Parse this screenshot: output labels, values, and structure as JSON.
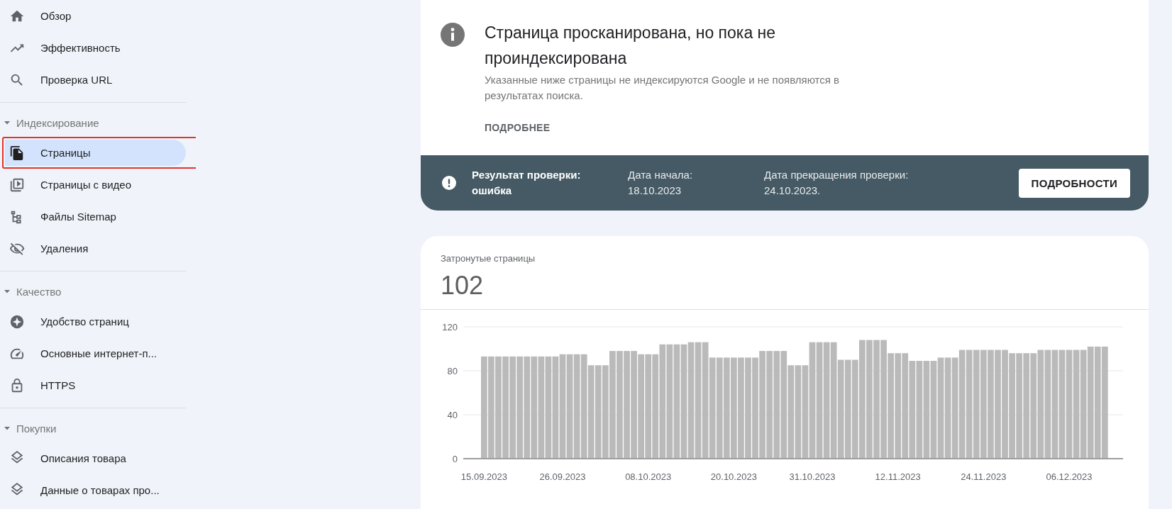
{
  "sidebar": {
    "sections": [
      {
        "items": [
          {
            "label": "Обзор",
            "selected": false,
            "outlined": false
          },
          {
            "label": "Эффективность",
            "selected": false,
            "outlined": false
          },
          {
            "label": "Проверка URL",
            "selected": false,
            "outlined": false
          }
        ]
      },
      {
        "header": "Индексирование",
        "expanded": true,
        "items": [
          {
            "label": "Страницы",
            "selected": true,
            "outlined": true
          },
          {
            "label": "Страницы с видео",
            "selected": false,
            "outlined": false
          },
          {
            "label": "Файлы Sitemap",
            "selected": false,
            "outlined": false
          },
          {
            "label": "Удаления",
            "selected": false,
            "outlined": false
          }
        ]
      },
      {
        "header": "Качество",
        "expanded": true,
        "items": [
          {
            "label": "Удобство страниц",
            "selected": false,
            "outlined": false
          },
          {
            "label": "Основные интернет-п...",
            "selected": false,
            "outlined": false
          },
          {
            "label": "HTTPS",
            "selected": false,
            "outlined": false
          }
        ]
      },
      {
        "header": "Покупки",
        "expanded": true,
        "items": [
          {
            "label": "Описания товара",
            "selected": false,
            "outlined": false
          },
          {
            "label": "Данные о товарах про...",
            "selected": false,
            "outlined": false
          }
        ]
      }
    ]
  },
  "issue": {
    "title": "Страница просканирована, но пока не проиндексирована",
    "description": "Указанные ниже страницы не индексируются Google и не появляются в результатах поиска.",
    "link": "ПОДРОБНЕЕ",
    "validation": {
      "result": "Результат проверки: ошибка",
      "start": "Дата начала: 18.10.2023",
      "end": "Дата прекращения проверки: 24.10.2023.",
      "button": "ПОДРОБНОСТИ"
    }
  },
  "affected": {
    "label": "Затронутые страницы",
    "count": "102",
    "chart_data": {
      "type": "bar",
      "yticks": [
        0,
        40,
        80,
        120
      ],
      "ylim": [
        0,
        120
      ],
      "categories": [
        "15.09.2023",
        null,
        null,
        null,
        null,
        null,
        null,
        null,
        null,
        null,
        null,
        "26.09.2023",
        null,
        null,
        null,
        null,
        null,
        null,
        null,
        null,
        null,
        null,
        null,
        "08.10.2023",
        null,
        null,
        null,
        null,
        null,
        null,
        null,
        null,
        null,
        null,
        null,
        "20.10.2023",
        null,
        null,
        null,
        null,
        null,
        null,
        null,
        null,
        null,
        null,
        "31.10.2023",
        null,
        null,
        null,
        null,
        null,
        null,
        null,
        null,
        null,
        null,
        null,
        "12.11.2023",
        null,
        null,
        null,
        null,
        null,
        null,
        null,
        null,
        null,
        null,
        null,
        "24.11.2023",
        null,
        null,
        null,
        null,
        null,
        null,
        null,
        null,
        null,
        null,
        null,
        "06.12.2023",
        null,
        null,
        null,
        null,
        null
      ],
      "values": [
        93,
        93,
        93,
        93,
        93,
        93,
        93,
        93,
        93,
        93,
        93,
        95,
        95,
        95,
        95,
        85,
        85,
        85,
        98,
        98,
        98,
        98,
        95,
        95,
        95,
        104,
        104,
        104,
        104,
        106,
        106,
        106,
        92,
        92,
        92,
        92,
        92,
        92,
        92,
        98,
        98,
        98,
        98,
        85,
        85,
        85,
        106,
        106,
        106,
        106,
        90,
        90,
        90,
        108,
        108,
        108,
        108,
        96,
        96,
        96,
        89,
        89,
        89,
        89,
        92,
        92,
        92,
        99,
        99,
        99,
        99,
        99,
        99,
        99,
        96,
        96,
        96,
        96,
        99,
        99,
        99,
        99,
        99,
        99,
        99,
        102,
        102,
        102
      ]
    }
  }
}
